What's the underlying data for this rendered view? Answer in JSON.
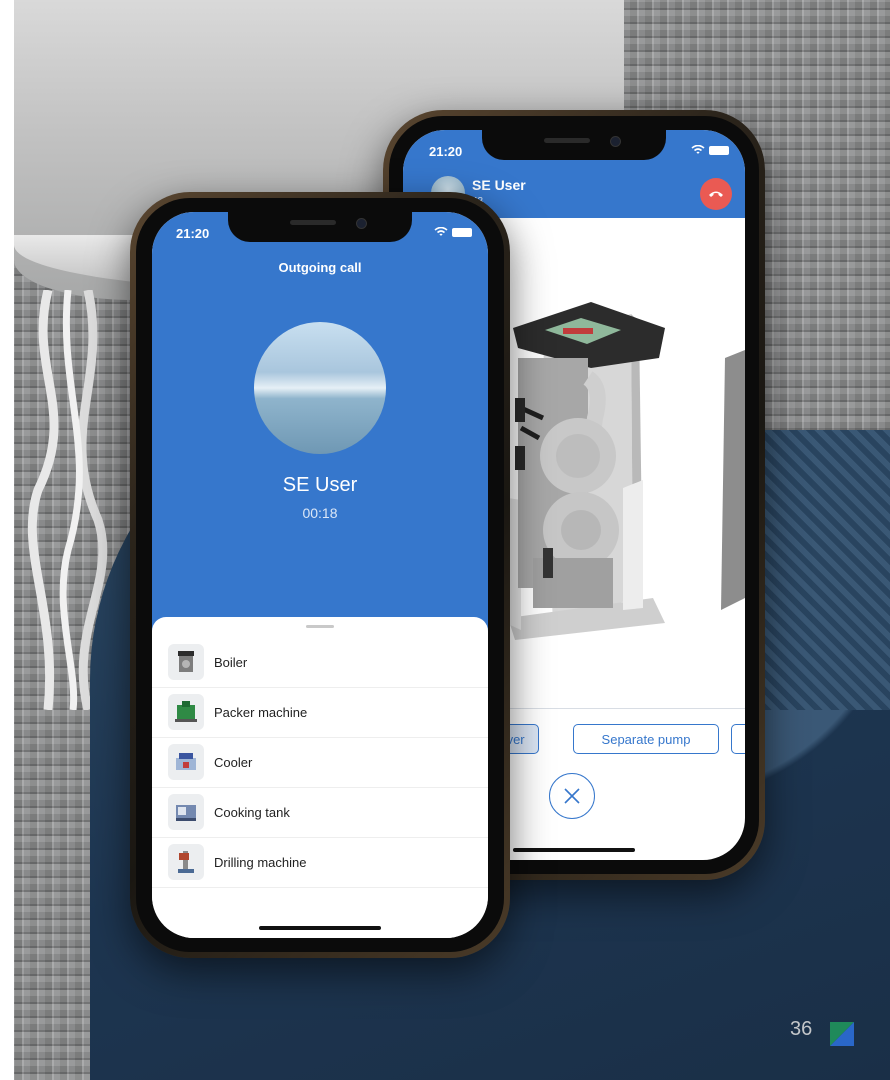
{
  "back_phone": {
    "status_time": "21:20",
    "caller_name": "SE User",
    "caller_time": "43",
    "parts": [
      "over",
      "Separate pump"
    ]
  },
  "front_phone": {
    "status_time": "21:20",
    "call_title": "Outgoing call",
    "caller_name": "SE User",
    "call_duration": "00:18",
    "devices": [
      {
        "label": "Boiler",
        "icon": "boiler-icon"
      },
      {
        "label": "Packer machine",
        "icon": "packer-machine-icon"
      },
      {
        "label": "Cooler",
        "icon": "cooler-icon"
      },
      {
        "label": "Cooking tank",
        "icon": "cooking-tank-icon"
      },
      {
        "label": "Drilling machine",
        "icon": "drilling-machine-icon"
      }
    ]
  },
  "slide": {
    "page_number": "36"
  },
  "colors": {
    "accent": "#3677cc",
    "hangup": "#ea5a53"
  }
}
